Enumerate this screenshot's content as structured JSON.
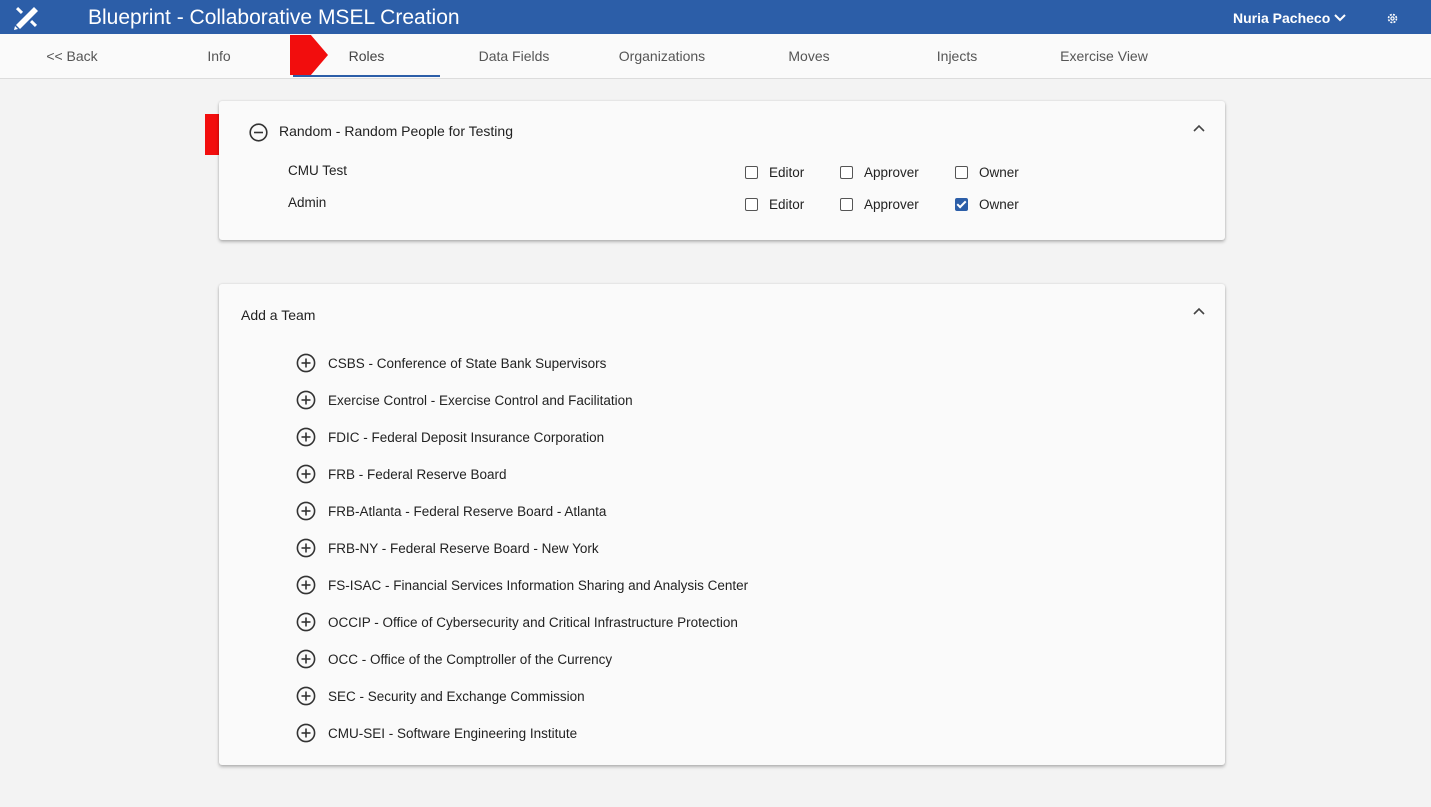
{
  "header": {
    "title": "Blueprint - Collaborative MSEL Creation",
    "user": "Nuria Pacheco",
    "logo_icon": "pencil-ruler-icon",
    "settings_icon": "gear-icon"
  },
  "tabs": [
    {
      "label": "<< Back"
    },
    {
      "label": "Info"
    },
    {
      "label": "Roles",
      "active": true
    },
    {
      "label": "Data Fields"
    },
    {
      "label": "Organizations"
    },
    {
      "label": "Moves"
    },
    {
      "label": "Injects"
    },
    {
      "label": "Exercise View"
    }
  ],
  "team_card": {
    "title": "Random - Random People for Testing",
    "roles": [
      {
        "name": "CMU Test",
        "editor": false,
        "approver": false,
        "owner": false
      },
      {
        "name": "Admin",
        "editor": false,
        "approver": false,
        "owner": true
      }
    ],
    "labels": {
      "editor": "Editor",
      "approver": "Approver",
      "owner": "Owner"
    }
  },
  "add_team": {
    "title": "Add a Team",
    "teams": [
      "CSBS - Conference of State Bank Supervisors",
      "Exercise Control - Exercise Control and Facilitation",
      "FDIC - Federal Deposit Insurance Corporation",
      "FRB - Federal Reserve Board",
      "FRB-Atlanta - Federal Reserve Board - Atlanta",
      "FRB-NY - Federal Reserve Board - New York",
      "FS-ISAC - Financial Services Information Sharing and Analysis Center",
      "OCCIP - Office of Cybersecurity and Critical Infrastructure Protection",
      "OCC - Office of the Comptroller of the Currency",
      "SEC - Security and Exchange Commission",
      "CMU-SEI - Software Engineering Institute"
    ]
  },
  "colors": {
    "header": "#2c5ea8",
    "marker": "#f20d0d",
    "checkbox_checked": "#2c5ea8"
  }
}
